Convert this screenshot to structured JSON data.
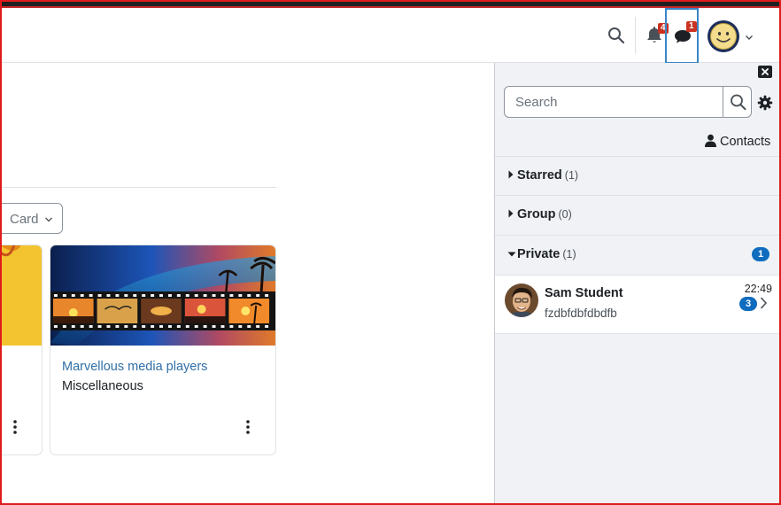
{
  "navbar": {
    "notifications_count": "4",
    "messages_count": "1"
  },
  "main": {
    "view_select": "Card",
    "courses": [
      {
        "title": "Marvellous media players",
        "category": "Miscellaneous"
      }
    ]
  },
  "drawer": {
    "search_placeholder": "Search",
    "contacts_label": "Contacts",
    "sections": [
      {
        "name": "Starred",
        "count": "(1)",
        "expanded": false
      },
      {
        "name": "Group",
        "count": "(0)",
        "expanded": false
      },
      {
        "name": "Private",
        "count": "(1)",
        "expanded": true,
        "unread": "1"
      }
    ],
    "conversations": [
      {
        "name": "Sam Student",
        "message": "fzdbfdbfdbdfb",
        "time": "22:49",
        "unread": "3"
      }
    ]
  },
  "colors": {
    "brand_blue": "#0f6cbf",
    "link": "#2f6fa7",
    "badge_red": "#ca3120",
    "focus_outline": "#3a86c8"
  }
}
